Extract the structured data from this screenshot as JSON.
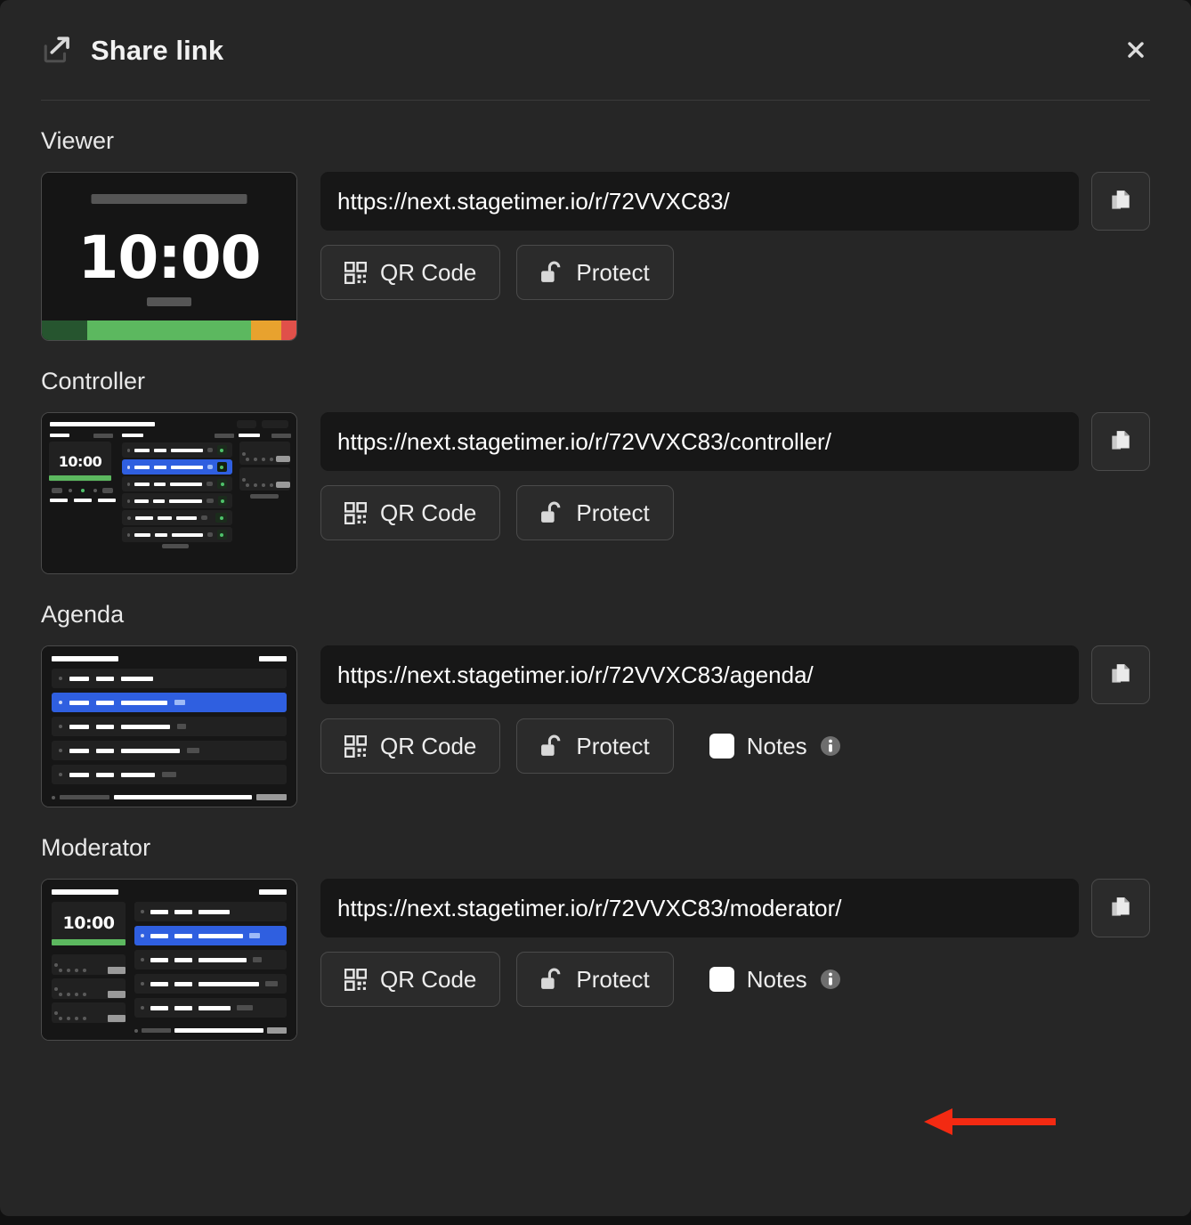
{
  "header": {
    "title": "Share link",
    "share_icon": "share-icon",
    "close_icon": "close-icon"
  },
  "common": {
    "qr_label": "QR Code",
    "protect_label": "Protect",
    "notes_label": "Notes",
    "qr_icon": "qr-code-icon",
    "lock_icon": "unlocked-padlock-icon",
    "copy_icon": "copy-icon",
    "info_icon": "info-icon",
    "checkbox_state": "unchecked"
  },
  "preview_timer_value": "10:00",
  "progress_colors": [
    "#26552f",
    "#5cb85f",
    "#e8a22e",
    "#e0504a"
  ],
  "accent_color": "#2f5fe0",
  "annotation": {
    "type": "arrow",
    "direction": "left",
    "color": "#f32a12",
    "points_at": "moderator-notes-checkbox"
  },
  "sections": [
    {
      "id": "viewer",
      "title": "Viewer",
      "url": "https://next.stagetimer.io/r/72VVXC83/",
      "has_notes": false
    },
    {
      "id": "controller",
      "title": "Controller",
      "url": "https://next.stagetimer.io/r/72VVXC83/controller/",
      "has_notes": false
    },
    {
      "id": "agenda",
      "title": "Agenda",
      "url": "https://next.stagetimer.io/r/72VVXC83/agenda/",
      "has_notes": true
    },
    {
      "id": "moderator",
      "title": "Moderator",
      "url": "https://next.stagetimer.io/r/72VVXC83/moderator/",
      "has_notes": true
    }
  ]
}
